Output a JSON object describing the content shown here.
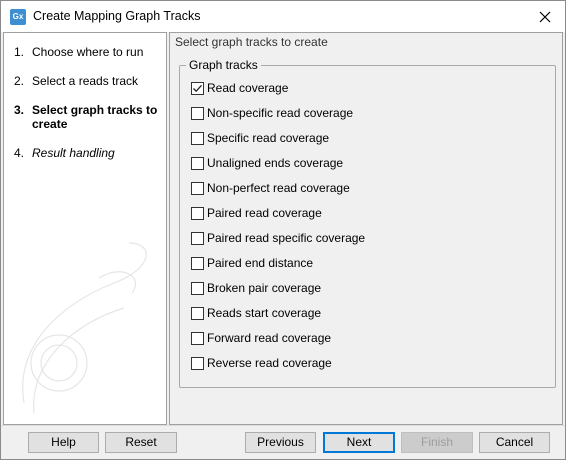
{
  "window": {
    "title": "Create Mapping Graph Tracks",
    "app_icon_text": "Gx"
  },
  "steps": [
    {
      "num": "1.",
      "label": "Choose where to run"
    },
    {
      "num": "2.",
      "label": "Select a reads track"
    },
    {
      "num": "3.",
      "label": "Select graph tracks to create",
      "active": true
    },
    {
      "num": "4.",
      "label": "Result handling"
    }
  ],
  "main": {
    "section_title": "Select graph tracks to create",
    "group_title": "Graph tracks",
    "tracks": [
      {
        "label": "Read coverage",
        "checked": true
      },
      {
        "label": "Non-specific read coverage",
        "checked": false
      },
      {
        "label": "Specific read coverage",
        "checked": false
      },
      {
        "label": "Unaligned ends coverage",
        "checked": false
      },
      {
        "label": "Non-perfect read coverage",
        "checked": false
      },
      {
        "label": "Paired read coverage",
        "checked": false
      },
      {
        "label": "Paired read specific coverage",
        "checked": false
      },
      {
        "label": "Paired end distance",
        "checked": false
      },
      {
        "label": "Broken pair coverage",
        "checked": false
      },
      {
        "label": "Reads start coverage",
        "checked": false
      },
      {
        "label": "Forward read coverage",
        "checked": false
      },
      {
        "label": "Reverse read coverage",
        "checked": false
      }
    ]
  },
  "footer": {
    "help": "Help",
    "reset": "Reset",
    "previous": "Previous",
    "next": "Next",
    "finish": "Finish",
    "cancel": "Cancel"
  },
  "colors": {
    "accent": "#0078d7",
    "app_icon": "#3d8fd1"
  },
  "icons": [
    "app-icon",
    "close-icon",
    "checkmark-icon"
  ]
}
